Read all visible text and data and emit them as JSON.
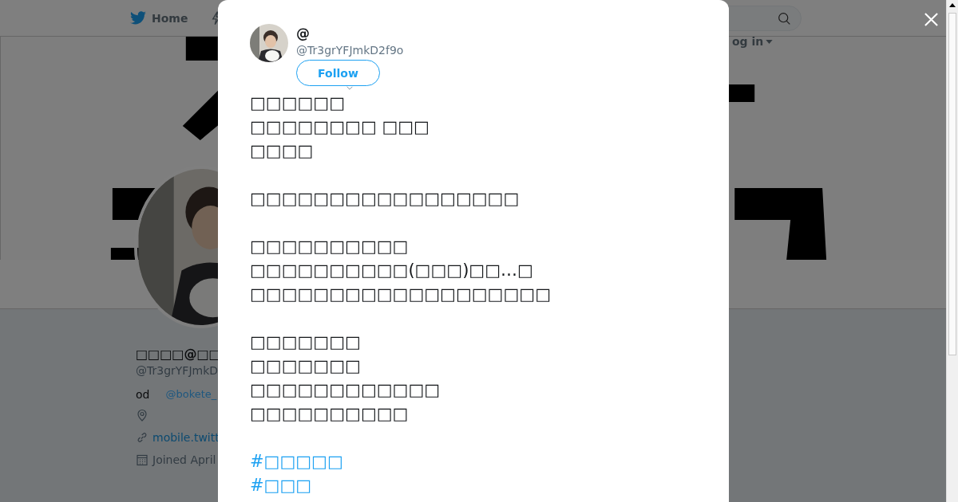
{
  "nav": {
    "home": "Home",
    "login": "og in"
  },
  "profile": {
    "name": "□□□□@□□",
    "handle": "@Tr3grYFJmkD",
    "bio_text": "od",
    "bio_link": "@bokete_",
    "url": "mobile.twitt",
    "joined": "Joined April"
  },
  "modal": {
    "name": "@",
    "handle": "@Tr3grYFJmkD2f9o",
    "follow": "Follow",
    "paragraphs": [
      [
        "□□□□□□",
        "□□□□□□□□ □□□",
        "□□□□"
      ],
      [
        "□□□□□□□□□□□□□□□□□"
      ],
      [
        "□□□□□□□□□□",
        "□□□□□□□□□□(□□□)□□…□",
        "□□□□□□□□□□□□□□□□□□□"
      ],
      [
        "□□□□□□□",
        "□□□□□□□",
        "□□□□□□□□□□□□",
        "□□□□□□□□□□"
      ]
    ],
    "hashtags": [
      "#□□□□□",
      "#□□□"
    ]
  }
}
